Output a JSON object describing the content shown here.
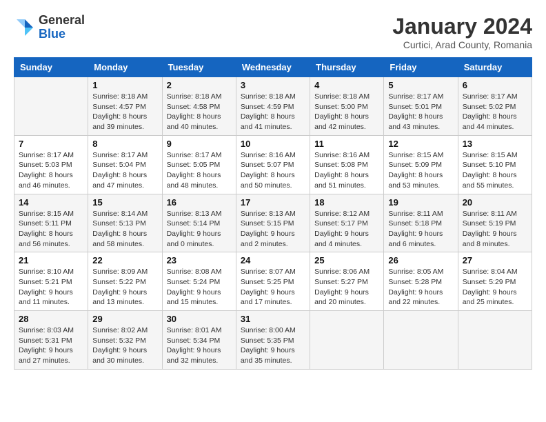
{
  "header": {
    "logo_general": "General",
    "logo_blue": "Blue",
    "title": "January 2024",
    "subtitle": "Curtici, Arad County, Romania"
  },
  "days_of_week": [
    "Sunday",
    "Monday",
    "Tuesday",
    "Wednesday",
    "Thursday",
    "Friday",
    "Saturday"
  ],
  "weeks": [
    [
      {
        "day": "",
        "info": ""
      },
      {
        "day": "1",
        "info": "Sunrise: 8:18 AM\nSunset: 4:57 PM\nDaylight: 8 hours\nand 39 minutes."
      },
      {
        "day": "2",
        "info": "Sunrise: 8:18 AM\nSunset: 4:58 PM\nDaylight: 8 hours\nand 40 minutes."
      },
      {
        "day": "3",
        "info": "Sunrise: 8:18 AM\nSunset: 4:59 PM\nDaylight: 8 hours\nand 41 minutes."
      },
      {
        "day": "4",
        "info": "Sunrise: 8:18 AM\nSunset: 5:00 PM\nDaylight: 8 hours\nand 42 minutes."
      },
      {
        "day": "5",
        "info": "Sunrise: 8:17 AM\nSunset: 5:01 PM\nDaylight: 8 hours\nand 43 minutes."
      },
      {
        "day": "6",
        "info": "Sunrise: 8:17 AM\nSunset: 5:02 PM\nDaylight: 8 hours\nand 44 minutes."
      }
    ],
    [
      {
        "day": "7",
        "info": "Sunrise: 8:17 AM\nSunset: 5:03 PM\nDaylight: 8 hours\nand 46 minutes."
      },
      {
        "day": "8",
        "info": "Sunrise: 8:17 AM\nSunset: 5:04 PM\nDaylight: 8 hours\nand 47 minutes."
      },
      {
        "day": "9",
        "info": "Sunrise: 8:17 AM\nSunset: 5:05 PM\nDaylight: 8 hours\nand 48 minutes."
      },
      {
        "day": "10",
        "info": "Sunrise: 8:16 AM\nSunset: 5:07 PM\nDaylight: 8 hours\nand 50 minutes."
      },
      {
        "day": "11",
        "info": "Sunrise: 8:16 AM\nSunset: 5:08 PM\nDaylight: 8 hours\nand 51 minutes."
      },
      {
        "day": "12",
        "info": "Sunrise: 8:15 AM\nSunset: 5:09 PM\nDaylight: 8 hours\nand 53 minutes."
      },
      {
        "day": "13",
        "info": "Sunrise: 8:15 AM\nSunset: 5:10 PM\nDaylight: 8 hours\nand 55 minutes."
      }
    ],
    [
      {
        "day": "14",
        "info": "Sunrise: 8:15 AM\nSunset: 5:11 PM\nDaylight: 8 hours\nand 56 minutes."
      },
      {
        "day": "15",
        "info": "Sunrise: 8:14 AM\nSunset: 5:13 PM\nDaylight: 8 hours\nand 58 minutes."
      },
      {
        "day": "16",
        "info": "Sunrise: 8:13 AM\nSunset: 5:14 PM\nDaylight: 9 hours\nand 0 minutes."
      },
      {
        "day": "17",
        "info": "Sunrise: 8:13 AM\nSunset: 5:15 PM\nDaylight: 9 hours\nand 2 minutes."
      },
      {
        "day": "18",
        "info": "Sunrise: 8:12 AM\nSunset: 5:17 PM\nDaylight: 9 hours\nand 4 minutes."
      },
      {
        "day": "19",
        "info": "Sunrise: 8:11 AM\nSunset: 5:18 PM\nDaylight: 9 hours\nand 6 minutes."
      },
      {
        "day": "20",
        "info": "Sunrise: 8:11 AM\nSunset: 5:19 PM\nDaylight: 9 hours\nand 8 minutes."
      }
    ],
    [
      {
        "day": "21",
        "info": "Sunrise: 8:10 AM\nSunset: 5:21 PM\nDaylight: 9 hours\nand 11 minutes."
      },
      {
        "day": "22",
        "info": "Sunrise: 8:09 AM\nSunset: 5:22 PM\nDaylight: 9 hours\nand 13 minutes."
      },
      {
        "day": "23",
        "info": "Sunrise: 8:08 AM\nSunset: 5:24 PM\nDaylight: 9 hours\nand 15 minutes."
      },
      {
        "day": "24",
        "info": "Sunrise: 8:07 AM\nSunset: 5:25 PM\nDaylight: 9 hours\nand 17 minutes."
      },
      {
        "day": "25",
        "info": "Sunrise: 8:06 AM\nSunset: 5:27 PM\nDaylight: 9 hours\nand 20 minutes."
      },
      {
        "day": "26",
        "info": "Sunrise: 8:05 AM\nSunset: 5:28 PM\nDaylight: 9 hours\nand 22 minutes."
      },
      {
        "day": "27",
        "info": "Sunrise: 8:04 AM\nSunset: 5:29 PM\nDaylight: 9 hours\nand 25 minutes."
      }
    ],
    [
      {
        "day": "28",
        "info": "Sunrise: 8:03 AM\nSunset: 5:31 PM\nDaylight: 9 hours\nand 27 minutes."
      },
      {
        "day": "29",
        "info": "Sunrise: 8:02 AM\nSunset: 5:32 PM\nDaylight: 9 hours\nand 30 minutes."
      },
      {
        "day": "30",
        "info": "Sunrise: 8:01 AM\nSunset: 5:34 PM\nDaylight: 9 hours\nand 32 minutes."
      },
      {
        "day": "31",
        "info": "Sunrise: 8:00 AM\nSunset: 5:35 PM\nDaylight: 9 hours\nand 35 minutes."
      },
      {
        "day": "",
        "info": ""
      },
      {
        "day": "",
        "info": ""
      },
      {
        "day": "",
        "info": ""
      }
    ]
  ]
}
